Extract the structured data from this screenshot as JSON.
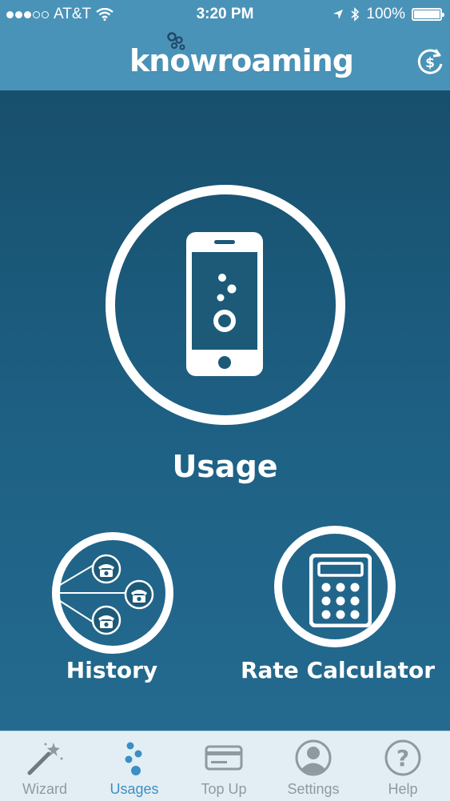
{
  "status_bar": {
    "carrier": "AT&T",
    "time": "3:20 PM",
    "battery": "100%",
    "battery_level": 1.0,
    "signal_bars_filled": 3,
    "signal_bars_total": 5
  },
  "header": {
    "logo_text": "knowroaming",
    "refresh_icon": "dollar-refresh-icon"
  },
  "main": {
    "usage_label": "Usage",
    "history_label": "History",
    "rate_calculator_label": "Rate Calculator"
  },
  "tab_bar": {
    "items": [
      {
        "label": "Wizard",
        "icon": "magic-wand-icon",
        "active": false
      },
      {
        "label": "Usages",
        "icon": "bubbles-icon",
        "active": true
      },
      {
        "label": "Top Up",
        "icon": "credit-card-icon",
        "active": false
      },
      {
        "label": "Settings",
        "icon": "user-icon",
        "active": false
      },
      {
        "label": "Help",
        "icon": "question-icon",
        "active": false
      }
    ]
  },
  "colors": {
    "header": "#4a93b8",
    "background_top": "#174f6c",
    "background_bottom": "#246a8f",
    "tab_active": "#3a8fc4",
    "tab_inactive": "#8f9aa0"
  }
}
